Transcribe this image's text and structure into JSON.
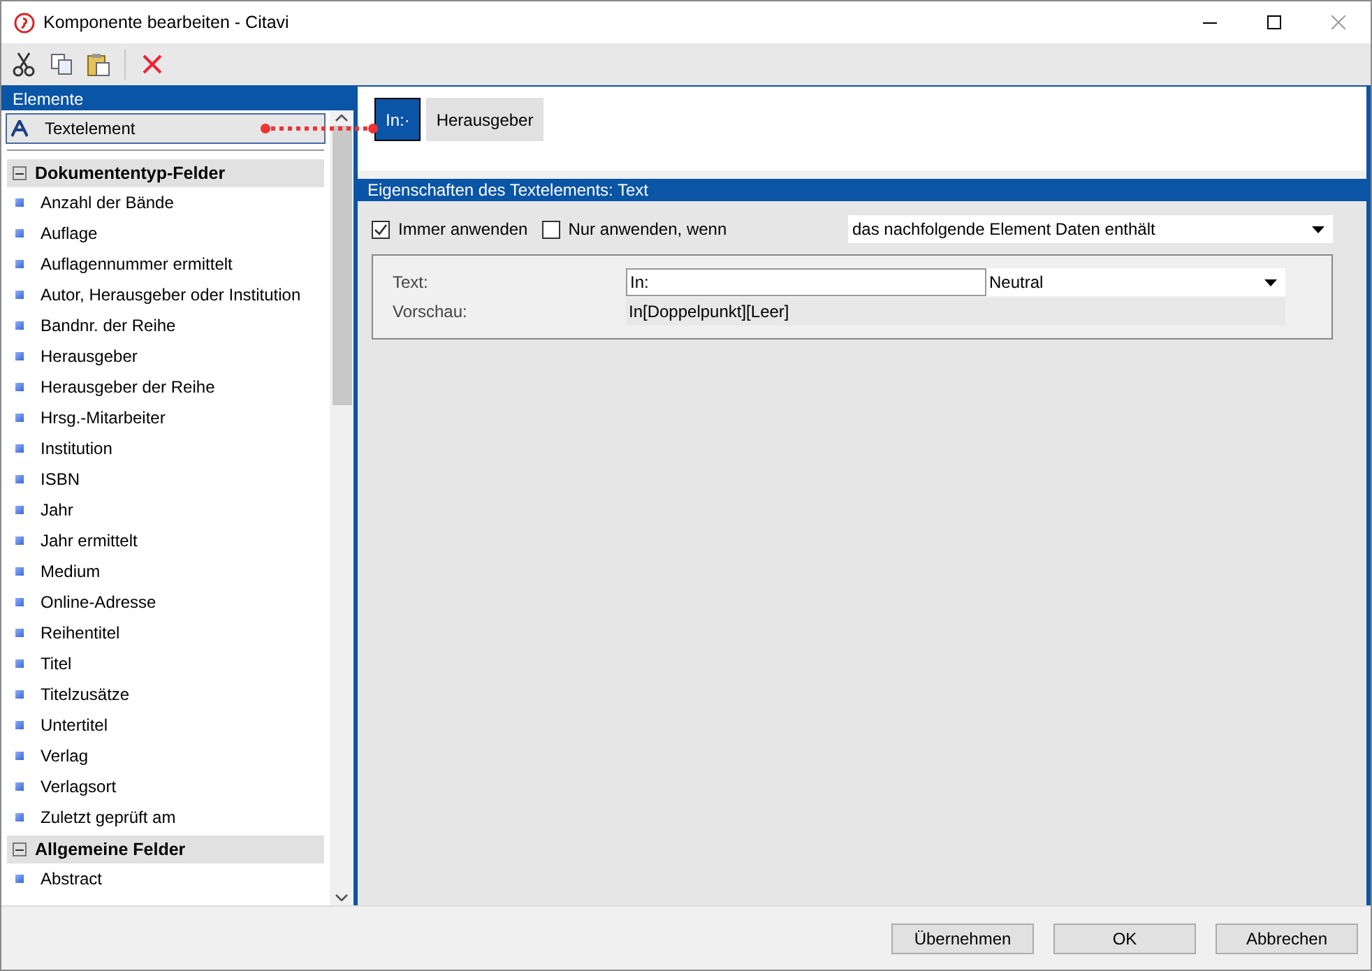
{
  "window": {
    "title": "Komponente bearbeiten - Citavi"
  },
  "toolbar": {
    "buttons": [
      {
        "kind": "cut",
        "disabled": false
      },
      {
        "kind": "copy",
        "disabled": false
      },
      {
        "kind": "paste",
        "disabled": false
      },
      {
        "kind": "delete",
        "disabled": false
      }
    ]
  },
  "elements_panel": {
    "title": "Elemente",
    "top_item": {
      "label": "Textelement",
      "selected": true
    },
    "groups": [
      {
        "label": "Dokumententyp-Felder",
        "expanded": true,
        "items": [
          "Anzahl der Bände",
          "Auflage",
          "Auflagennummer ermittelt",
          "Autor, Herausgeber oder Institution",
          "Bandnr. der Reihe",
          "Herausgeber",
          "Herausgeber der Reihe",
          "Hrsg.-Mitarbeiter",
          "Institution",
          "ISBN",
          "Jahr",
          "Jahr ermittelt",
          "Medium",
          "Online-Adresse",
          "Reihentitel",
          "Titel",
          "Titelzusätze",
          "Untertitel",
          "Verlag",
          "Verlagsort",
          "Zuletzt geprüft am"
        ]
      },
      {
        "label": "Allgemeine Felder",
        "expanded": true,
        "items": [
          "Abstract"
        ]
      }
    ]
  },
  "component": {
    "parts": [
      {
        "label": "In:·",
        "selected": true
      },
      {
        "label": "Herausgeber",
        "selected": false
      }
    ]
  },
  "properties": {
    "title": "Eigenschaften des Textelements:  Text",
    "always_apply": {
      "label": "Immer anwenden",
      "checked": true
    },
    "conditional": {
      "label": "Nur anwenden, wenn",
      "checked": false
    },
    "condition_select": "das nachfolgende Element Daten enthält",
    "text_label": "Text:",
    "text_value": "In:",
    "style_select": "Neutral",
    "preview_label": "Vorschau:",
    "preview_value": "In[Doppelpunkt][Leer]"
  },
  "buttons": [
    "Übernehmen",
    "OK",
    "Abbrechen"
  ]
}
